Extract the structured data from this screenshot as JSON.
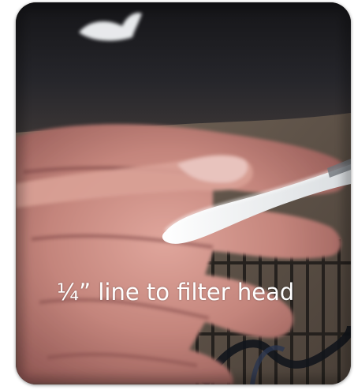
{
  "photo": {
    "description_icon": "photo-image",
    "colors": {
      "dark_fabric": "#1c1b1e",
      "skin": "#c98f86",
      "skin_shadow": "#8a4f4c",
      "tubing": "#f4f4f0",
      "wire": "#1b1e26"
    }
  },
  "caption": {
    "text": "¼” line to filter head"
  }
}
